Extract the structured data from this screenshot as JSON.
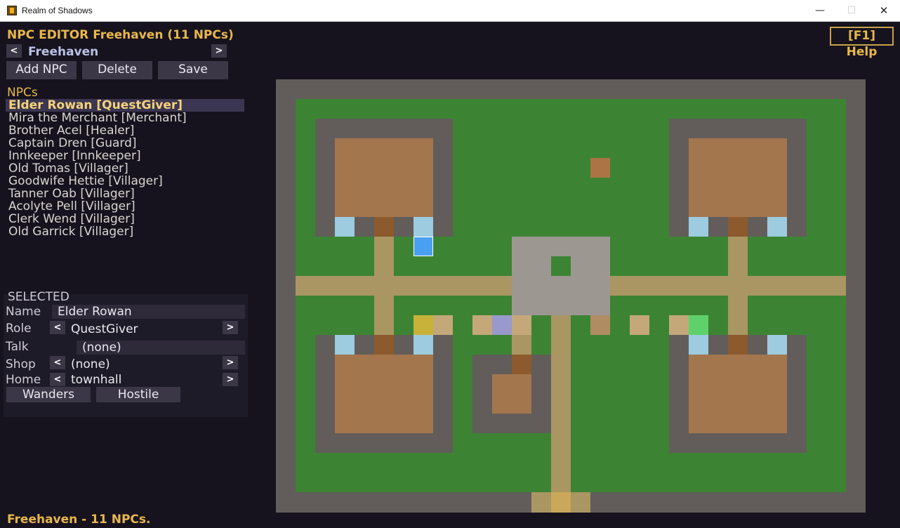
{
  "window": {
    "title": "Realm of Shadows",
    "minimize": "—",
    "maximize": "☐",
    "close": "✕"
  },
  "editor": {
    "title": "NPC EDITOR  Freehaven  (11 NPCs)",
    "help_label": "[F1] Help",
    "town_name": "Freehaven",
    "prev_arrow": "<",
    "next_arrow": ">",
    "add_label": "Add NPC",
    "delete_label": "Delete",
    "save_label": "Save"
  },
  "npc_list": {
    "header": "NPCs",
    "items": [
      "Elder Rowan  [QuestGiver]",
      "Mira the Merchant  [Merchant]",
      "Brother Acel  [Healer]",
      "Captain Dren  [Guard]",
      "Innkeeper  [Innkeeper]",
      "Old Tomas  [Villager]",
      "Goodwife Hettie  [Villager]",
      "Tanner Oab  [Villager]",
      "Acolyte Pell  [Villager]",
      "Clerk Wend  [Villager]",
      "Old Garrick  [Villager]"
    ],
    "selected_index": 0
  },
  "selected": {
    "header": "SELECTED",
    "name_label": "Name",
    "name_value": "Elder Rowan",
    "role_label": "Role",
    "role_value": "QuestGiver",
    "talk_label": "Talk",
    "talk_value": "(none)",
    "shop_label": "Shop",
    "shop_value": "(none)",
    "home_label": "Home",
    "home_value": "townhall",
    "left_arrow": "<",
    "right_arrow": ">",
    "wanders_label": "Wanders",
    "hostile_label": "Hostile"
  },
  "status": "Freehaven - 11 NPCs.",
  "colors": {
    "gold": "#e8b84a",
    "wall": "#625d5a",
    "grass": "#3c8433",
    "floor": "#a3764d",
    "path": "#aa9663",
    "plaza": "#9d9792",
    "door": "#8c5a2c",
    "window": "#9dcbe0",
    "selected_npc": "#4aa0f0"
  }
}
